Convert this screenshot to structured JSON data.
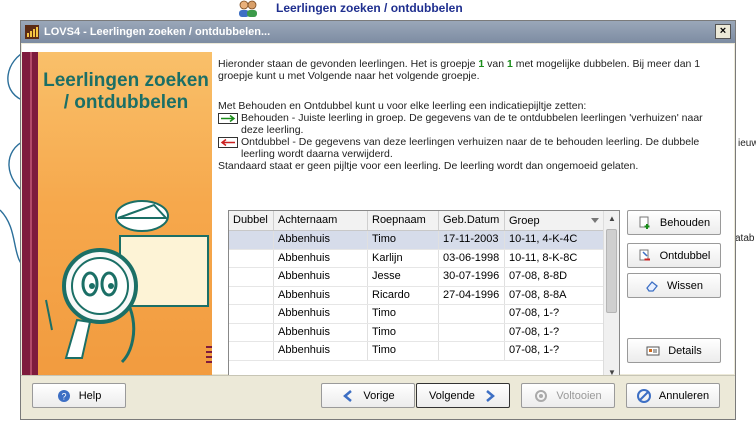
{
  "background": {
    "title": "Leerlingen zoeken / ontdubbelen",
    "right_text_1": "ieuw",
    "right_text_2": "atab"
  },
  "window": {
    "title": "LOVS4 - Leerlingen zoeken / ontdubbelen...",
    "close_label": "×"
  },
  "side": {
    "title": "Leerlingen zoeken / ontdubbelen"
  },
  "intro": {
    "part1": "Hieronder staan de gevonden leerlingen. Het is groepje ",
    "group_current": "1",
    "part2": " van ",
    "group_total": "1",
    "part3": " met mogelijke dubbelen. Bij meer dan 1 groepje kunt u met Volgende naar het volgende groepje."
  },
  "legend": {
    "intro": "Met Behouden en Ontdubbel kunt u voor elke leerling een indicatiepijltje zetten:",
    "behouden": "Behouden - Juiste leerling in groep. De gegevens van de te ontdubbelen leerlingen 'verhuizen' naar deze leerling.",
    "ontdubbel": "Ontdubbel - De gegevens van deze leerlingen verhuizen naar de te behouden leerling. De dubbele leerling wordt daarna verwijderd.",
    "standaard": "Standaard staat er geen pijltje voor een leerling. De leerling wordt dan ongemoeid gelaten.",
    "behouden_color": "#1a8c1a",
    "ontdubbel_color": "#cc2222"
  },
  "table": {
    "columns": [
      "Dubbel",
      "Achternaam",
      "Roepnaam",
      "Geb.Datum",
      "Groep"
    ],
    "rows": [
      [
        "",
        "Abbenhuis",
        "Timo",
        "17-11-2003",
        "10-11, 4-K-4C"
      ],
      [
        "",
        "Abbenhuis",
        "Karlijn",
        "03-06-1998",
        "10-11, 8-K-8C"
      ],
      [
        "",
        "Abbenhuis",
        "Jesse",
        "30-07-1996",
        "07-08, 8-8D"
      ],
      [
        "",
        "Abbenhuis",
        "Ricardo",
        "27-04-1996",
        "07-08, 8-8A"
      ],
      [
        "",
        "Abbenhuis",
        "Timo",
        "",
        "07-08, 1-?"
      ],
      [
        "",
        "Abbenhuis",
        "Timo",
        "",
        "07-08, 1-?"
      ],
      [
        "",
        "Abbenhuis",
        "Timo",
        "",
        "07-08, 1-?"
      ]
    ]
  },
  "buttons": {
    "behouden": "Behouden",
    "ontdubbel": "Ontdubbel",
    "wissen": "Wissen",
    "details": "Details",
    "help": "Help",
    "vorige": "Vorige",
    "volgende": "Volgende",
    "voltooien": "Voltooien",
    "annuleren": "Annuleren"
  }
}
